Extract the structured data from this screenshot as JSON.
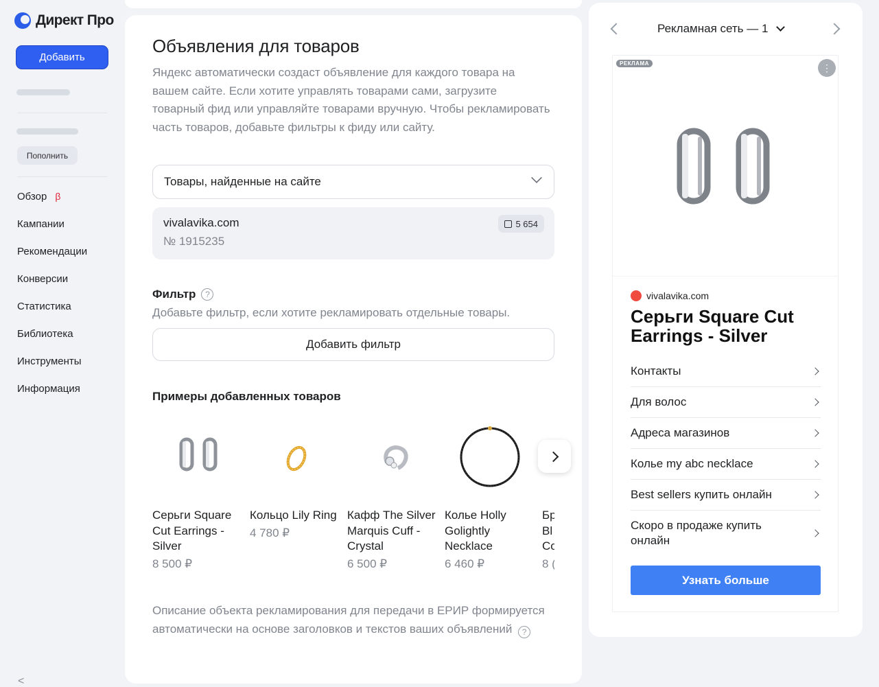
{
  "sidebar": {
    "logo_text": "Директ Про",
    "add_button": "Добавить",
    "topup_button": "Пополнить",
    "nav": [
      {
        "label": "Обзор",
        "badge": "β"
      },
      {
        "label": "Кампании"
      },
      {
        "label": "Рекомендации"
      },
      {
        "label": "Конверсии"
      },
      {
        "label": "Статистика"
      },
      {
        "label": "Библиотека"
      },
      {
        "label": "Инструменты"
      },
      {
        "label": "Информация"
      }
    ],
    "collapse_glyph": "<"
  },
  "main": {
    "title": "Объявления для товаров",
    "description": "Яндекс автоматически создаст объявление для каждого товара на вашем сайте. Если хотите управлять товарами сами, загрузите товарный фид или управляйте товарами вручную. Чтобы рекламировать часть товаров, добавьте фильтры к фиду или сайту.",
    "source_select": "Товары, найденные на сайте",
    "site": {
      "name": "vivalavika.com",
      "number": "№ 1915235",
      "count": "5 654"
    },
    "filter": {
      "title": "Фильтр",
      "help": "?",
      "hint": "Добавьте фильтр, если хотите рекламировать отдельные товары.",
      "button": "Добавить фильтр"
    },
    "examples_title": "Примеры добавленных товаров",
    "products": [
      {
        "name": "Серьги Square Cut Earrings - Silver",
        "price": "8 500 ₽",
        "icon": "earrings-image"
      },
      {
        "name": "Кольцо Lily Ring",
        "price": "4 780 ₽",
        "icon": "ring-image"
      },
      {
        "name": "Кафф The Silver Marquis Cuff - Crystal",
        "price": "6 500 ₽",
        "icon": "cuff-image"
      },
      {
        "name": "Колье Holly Golightly Necklace",
        "price": "6 460 ₽",
        "icon": "necklace-image"
      },
      {
        "name": "Бр\nBl\nCo",
        "price": "8 (",
        "icon": "bracelet-image"
      }
    ],
    "erip_note": "Описание объекта рекламирования для передачи в ЕРИР формируется автоматически на основе заголовков и текстов ваших объявлений"
  },
  "preview": {
    "selector": "Рекламная сеть — 1",
    "ad_label": "РЕКЛАМА",
    "menu_glyph": "⋮",
    "domain": "vivalavika.com",
    "title": "Серьги Square Cut Earrings - Silver",
    "links": [
      "Контакты",
      "Для волос",
      "Адреса магазинов",
      "Колье my abc necklace",
      "Best sellers купить онлайн",
      "Скоро в продаже купить онлайн"
    ],
    "cta": "Узнать больше"
  },
  "colors": {
    "accent": "#2f5ff0",
    "cta": "#3f80f5",
    "beta": "#e0263a",
    "favicon": "#ef4b3f",
    "background": "#f1f3f7"
  }
}
